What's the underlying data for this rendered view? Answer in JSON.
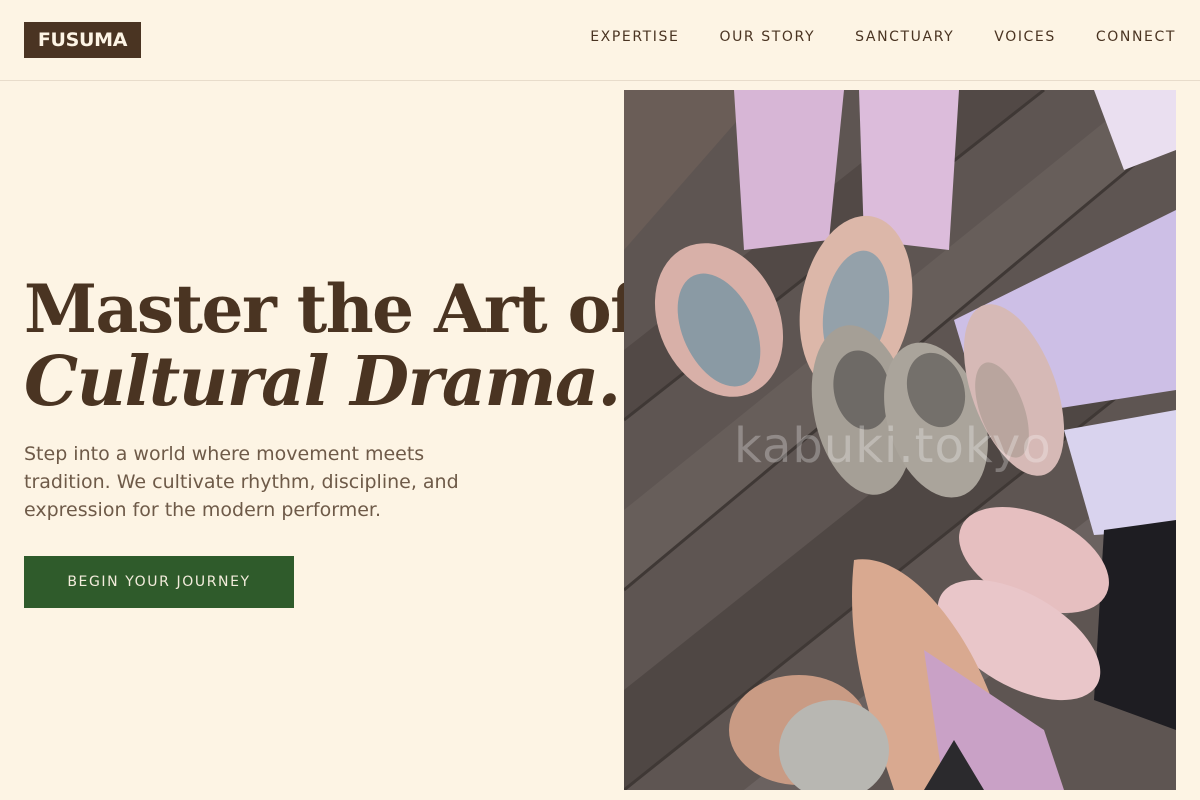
{
  "brand": {
    "logo": "FUSUMA"
  },
  "nav": {
    "items": [
      {
        "label": "EXPERTISE"
      },
      {
        "label": "OUR STORY"
      },
      {
        "label": "SANCTUARY"
      },
      {
        "label": "VOICES"
      },
      {
        "label": "CONNECT"
      }
    ]
  },
  "hero": {
    "title_line1": "Master the Art of",
    "title_line2": "Cultural Drama.",
    "description": "Step into a world where movement meets tradition. We cultivate rhythm, discipline, and expression for the modern performer.",
    "cta_label": "BEGIN YOUR JOURNEY",
    "image_watermark": "kabuki.tokyo"
  },
  "colors": {
    "background": "#fdf4e4",
    "text_dark": "#4a3422",
    "cta_green": "#2f5b2b"
  }
}
